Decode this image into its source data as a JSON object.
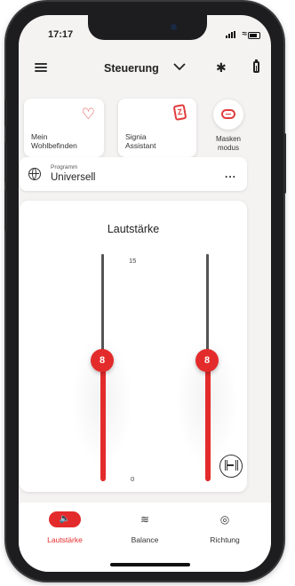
{
  "status_bar": {
    "time": "17:17"
  },
  "header": {
    "title": "Steuerung"
  },
  "quick_cards": [
    {
      "label": "Mein\nWohlbefinden"
    },
    {
      "label": "Signia\nAssistant"
    }
  ],
  "mask_mode": {
    "label": "Masken\nmodus"
  },
  "program": {
    "caption": "Programm",
    "name": "Universell",
    "more": "..."
  },
  "volume": {
    "title": "Lautstärke",
    "max_label": "15",
    "min_label": "0",
    "left_value": "8",
    "right_value": "8",
    "left_level_fraction": 0.53,
    "right_level_fraction": 0.53
  },
  "bottom_nav": {
    "items": [
      {
        "label": "Lautstärke",
        "active": true
      },
      {
        "label": "Balance",
        "active": false
      },
      {
        "label": "Richtung",
        "active": false
      }
    ]
  },
  "colors": {
    "accent": "#e42b2b",
    "background": "#f4f3f2"
  }
}
